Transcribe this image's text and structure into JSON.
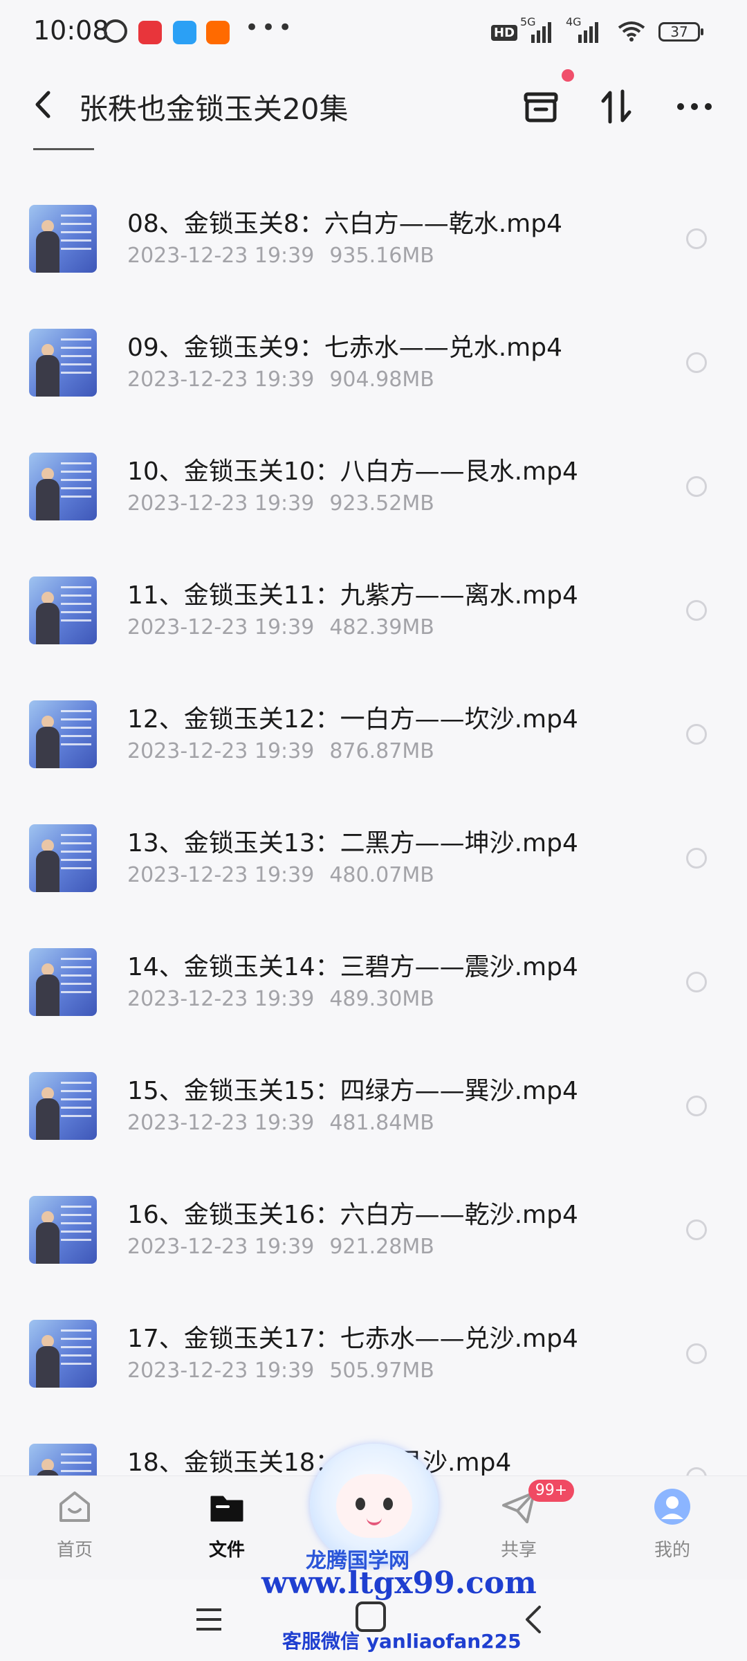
{
  "status_bar": {
    "time": "10:08",
    "dots": "•••",
    "hd": "HD",
    "net1": "5G",
    "net2": "4G",
    "battery": "37"
  },
  "header": {
    "title": "张秩也金锁玉关20集"
  },
  "files": [
    {
      "name": "08、金锁玉关8：六白方——乾水.mp4",
      "date": "2023-12-23  19:39",
      "size": "935.16MB"
    },
    {
      "name": "09、金锁玉关9：七赤水——兑水.mp4",
      "date": "2023-12-23  19:39",
      "size": "904.98MB"
    },
    {
      "name": "10、金锁玉关10：八白方——艮水.mp4",
      "date": "2023-12-23  19:39",
      "size": "923.52MB"
    },
    {
      "name": "11、金锁玉关11：九紫方——离水.mp4",
      "date": "2023-12-23  19:39",
      "size": "482.39MB"
    },
    {
      "name": "12、金锁玉关12：一白方——坎沙.mp4",
      "date": "2023-12-23  19:39",
      "size": "876.87MB"
    },
    {
      "name": "13、金锁玉关13：二黑方——坤沙.mp4",
      "date": "2023-12-23  19:39",
      "size": "480.07MB"
    },
    {
      "name": "14、金锁玉关14：三碧方——震沙.mp4",
      "date": "2023-12-23  19:39",
      "size": "489.30MB"
    },
    {
      "name": "15、金锁玉关15：四绿方——巽沙.mp4",
      "date": "2023-12-23  19:39",
      "size": "481.84MB"
    },
    {
      "name": "16、金锁玉关16：六白方——乾沙.mp4",
      "date": "2023-12-23  19:39",
      "size": "921.28MB"
    },
    {
      "name": "17、金锁玉关17：七赤水——兑沙.mp4",
      "date": "2023-12-23  19:39",
      "size": "505.97MB"
    },
    {
      "name": "18、金锁玉关18：        ——艮沙.mp4",
      "date": "",
      "size": ""
    }
  ],
  "bottom_nav": {
    "home": "首页",
    "files": "文件",
    "share": "共享",
    "mine": "我的",
    "share_badge": "99+"
  },
  "watermark": {
    "brand": "龙腾国学网",
    "url": "www.ltgx99.com",
    "contact": "客服微信 yanliaofan225"
  },
  "icons": {
    "back": "back-arrow-icon",
    "archive": "archive-box-icon",
    "sort": "sort-arrows-icon",
    "more": "more-dots-icon"
  },
  "colors": {
    "background": "#f7f7f9",
    "accent_red": "#f04a63",
    "meta_text": "#a3a3a8",
    "watermark_blue": "#1f3fd0"
  }
}
